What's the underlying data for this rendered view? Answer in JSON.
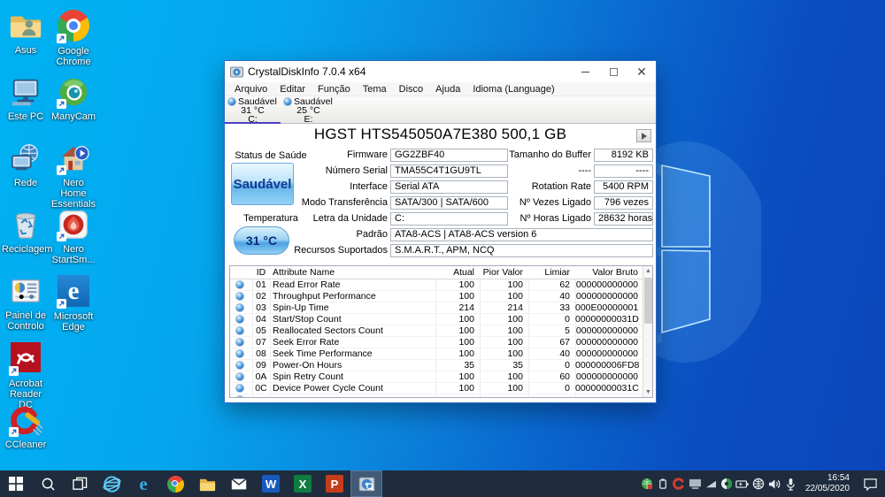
{
  "colors": {
    "accent": "#0078d7",
    "taskbar": "#1f2c3d",
    "wallpaper_left": "#00aef2",
    "wallpaper_right": "#0a46ba",
    "health_button_text": "#123c94"
  },
  "desktop": {
    "icons": [
      {
        "label": "Asus",
        "icon": "user-folder-icon"
      },
      {
        "label": "Google Chrome",
        "icon": "chrome-icon"
      },
      {
        "label": "Este PC",
        "icon": "this-pc-icon"
      },
      {
        "label": "ManyCam",
        "icon": "manycam-icon"
      },
      {
        "label": "Rede",
        "icon": "network-icon"
      },
      {
        "label": "Nero Home Essentials SE",
        "icon": "nero-home-icon"
      },
      {
        "label": "Reciclagem",
        "icon": "recycle-bin-icon"
      },
      {
        "label": "Nero StartSm...",
        "icon": "nero-startsmart-icon"
      },
      {
        "label": "Painel de Controlo",
        "icon": "control-panel-icon"
      },
      {
        "label": "Microsoft Edge",
        "icon": "edge-icon"
      },
      {
        "label": "Acrobat Reader DC",
        "icon": "acrobat-icon"
      },
      {
        "label": "CCleaner",
        "icon": "ccleaner-icon"
      }
    ]
  },
  "window": {
    "title": "CrystalDiskInfo 7.0.4 x64",
    "menu": [
      "Arquivo",
      "Editar",
      "Função",
      "Tema",
      "Disco",
      "Ajuda",
      "Idioma (Language)"
    ],
    "tabs": [
      {
        "status": "Saudável",
        "temp": "31 °C",
        "drive": "C:",
        "active": true
      },
      {
        "status": "Saudável",
        "temp": "25 °C",
        "drive": "E:",
        "active": false
      }
    ],
    "drive_title": "HGST HTS545050A7E380 500,1 GB",
    "health": {
      "label": "Status de Saúde",
      "value": "Saudável"
    },
    "temperature": {
      "label": "Temperatura",
      "value": "31 °C"
    },
    "fields_left": [
      {
        "label": "Firmware",
        "value": "GG2ZBF40"
      },
      {
        "label": "Número Serial",
        "value": "TMA55C4T1GU9TL"
      },
      {
        "label": "Interface",
        "value": "Serial ATA"
      },
      {
        "label": "Modo Transferência",
        "value": "SATA/300 | SATA/600"
      },
      {
        "label": "Letra da Unidade",
        "value": "C:"
      }
    ],
    "fields_right": [
      {
        "label": "Tamanho do Buffer",
        "value": "8192 KB"
      },
      {
        "label": "----",
        "value": "----"
      },
      {
        "label": "Rotation Rate",
        "value": "5400 RPM"
      },
      {
        "label": "Nº Vezes Ligado",
        "value": "796 vezes"
      },
      {
        "label": "Nº Horas Ligado",
        "value": "28632 horas"
      }
    ],
    "fields_full": [
      {
        "label": "Padrão",
        "value": "ATA8-ACS | ATA8-ACS version 6"
      },
      {
        "label": "Recursos Suportados",
        "value": "S.M.A.R.T., APM, NCQ"
      }
    ],
    "table": {
      "headers": [
        "ID",
        "Attribute Name",
        "Atual",
        "Pior Valor",
        "Limiar",
        "Valor Bruto"
      ],
      "rows": [
        [
          "01",
          "Read Error Rate",
          "100",
          "100",
          "62",
          "000000000000"
        ],
        [
          "02",
          "Throughput Performance",
          "100",
          "100",
          "40",
          "000000000000"
        ],
        [
          "03",
          "Spin-Up Time",
          "214",
          "214",
          "33",
          "000E00000001"
        ],
        [
          "04",
          "Start/Stop Count",
          "100",
          "100",
          "0",
          "00000000031D"
        ],
        [
          "05",
          "Reallocated Sectors Count",
          "100",
          "100",
          "5",
          "000000000000"
        ],
        [
          "07",
          "Seek Error Rate",
          "100",
          "100",
          "67",
          "000000000000"
        ],
        [
          "08",
          "Seek Time Performance",
          "100",
          "100",
          "40",
          "000000000000"
        ],
        [
          "09",
          "Power-On Hours",
          "35",
          "35",
          "0",
          "000000006FD8"
        ],
        [
          "0A",
          "Spin Retry Count",
          "100",
          "100",
          "60",
          "000000000000"
        ],
        [
          "0C",
          "Device Power Cycle Count",
          "100",
          "100",
          "0",
          "00000000031C"
        ]
      ]
    }
  },
  "taskbar": {
    "apps": [
      "start",
      "search",
      "task-view",
      "internet-explorer",
      "edge",
      "chrome",
      "file-explorer",
      "mail",
      "word",
      "excel",
      "powerpoint",
      "crystaldiskinfo"
    ],
    "tray_icons": [
      "sync-app",
      "usb-device",
      "ccleaner",
      "display",
      "graphics",
      "manycam",
      "battery",
      "network",
      "volume",
      "microphone"
    ],
    "clock": {
      "time": "16:54",
      "date": "22/05/2020"
    }
  }
}
